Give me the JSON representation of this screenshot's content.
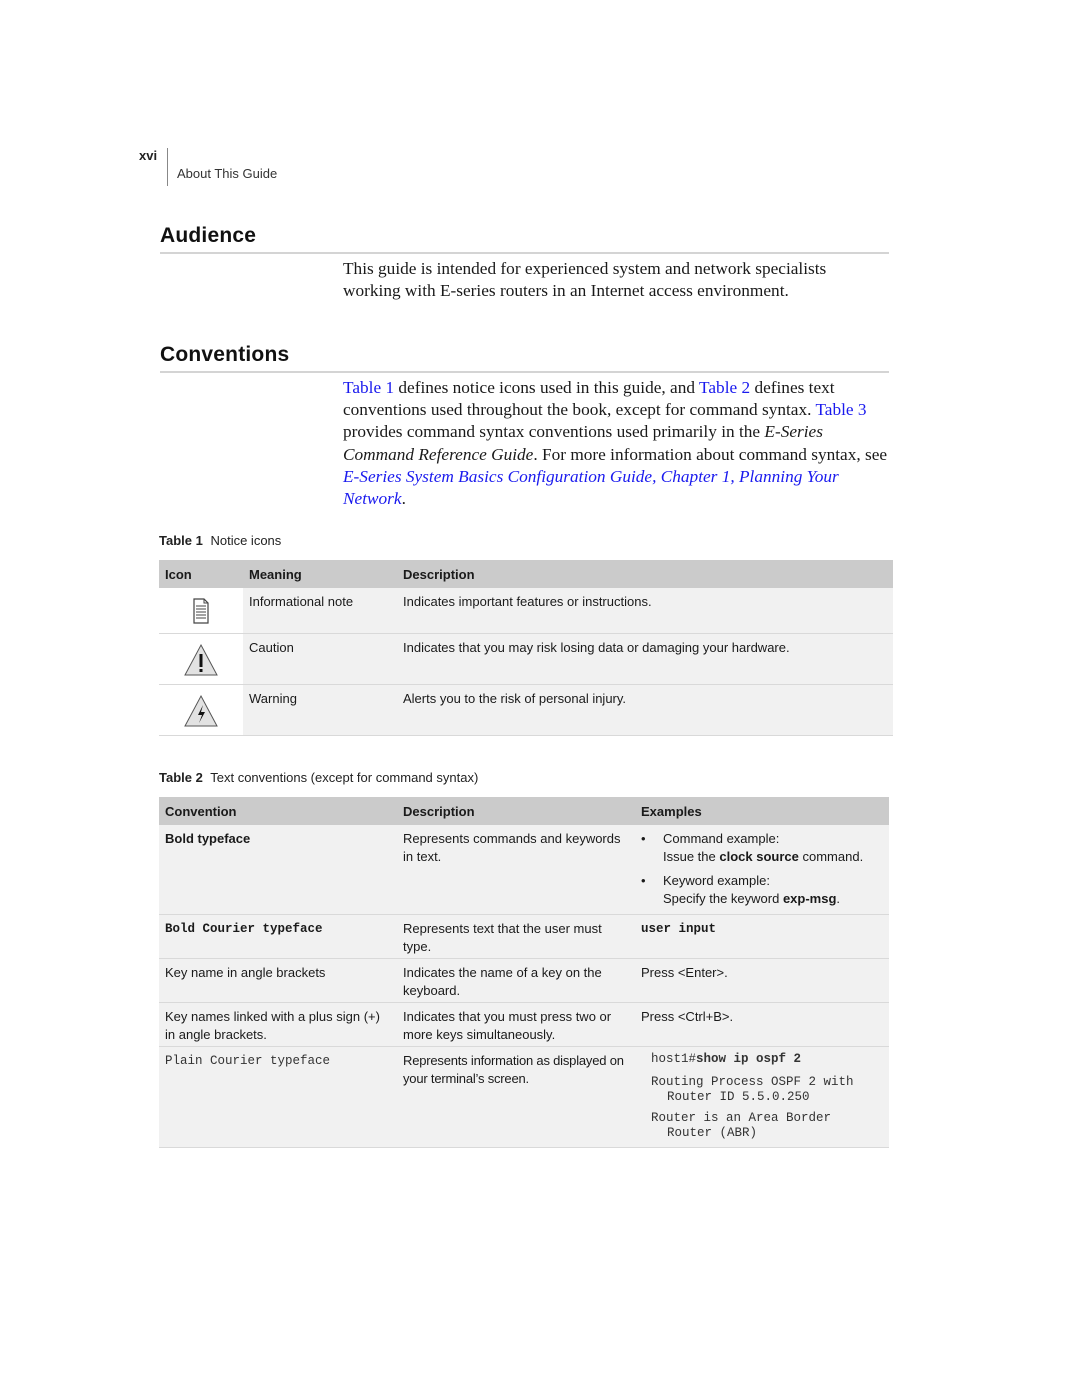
{
  "header": {
    "page_number": "xvi",
    "running_head": "About This Guide"
  },
  "audience": {
    "heading": "Audience",
    "paragraph": "This guide is intended for experienced system and network specialists working with E-series routers in an Internet access environment."
  },
  "conventions": {
    "heading": "Conventions",
    "paragraph": {
      "link_table1": "Table 1",
      "text1": " defines notice icons used in this guide, and ",
      "link_table2": "Table 2",
      "text2": " defines text conventions used throughout the book, except for command syntax. ",
      "link_table3": "Table 3",
      "text3": " provides command syntax conventions used primarily in the ",
      "italic_ref": "E-Series Command Reference Guide",
      "text4": ". For more information about command syntax, see ",
      "link_guide": "E-Series System Basics Configuration Guide, Chapter 1, Planning Your Network",
      "text5": "."
    },
    "colors": {
      "link": "#1a1aee",
      "header_bg": "#cbcbcb",
      "row_bg": "#f1f1f1"
    }
  },
  "table1": {
    "caption_label": "Table 1",
    "caption_text": "Notice icons",
    "headers": [
      "Icon",
      "Meaning",
      "Description"
    ],
    "rows": [
      {
        "icon": "note-icon",
        "meaning": "Informational note",
        "description": "Indicates important features or instructions."
      },
      {
        "icon": "caution-icon",
        "meaning": "Caution",
        "description": "Indicates that you may risk losing data or damaging your hardware."
      },
      {
        "icon": "warning-icon",
        "meaning": "Warning",
        "description": "Alerts you to the risk of personal injury."
      }
    ]
  },
  "table2": {
    "caption_label": "Table 2",
    "caption_text": "Text conventions (except for command syntax)",
    "headers": [
      "Convention",
      "Description",
      "Examples"
    ],
    "rows": [
      {
        "convention": "Bold typeface",
        "description": "Represents commands and keywords in text.",
        "examples": [
          {
            "bullet": "•",
            "line1": "Command example:",
            "pre": "Issue the ",
            "bold": "clock source",
            "post": " command."
          },
          {
            "bullet": "•",
            "line1": "Keyword example:",
            "pre": "Specify the keyword ",
            "bold": "exp-msg",
            "post": "."
          }
        ]
      },
      {
        "convention": "Bold Courier typeface",
        "description": "Represents text that the user must type.",
        "example": "user input"
      },
      {
        "convention": "Key name in angle brackets",
        "description": "Indicates the name of a key on the keyboard.",
        "example": "Press <Enter>."
      },
      {
        "convention": "Key names linked with a plus sign (+) in angle brackets.",
        "description": "Indicates that you must press two or more keys simultaneously.",
        "example": "Press <Ctrl+B>."
      },
      {
        "convention": "Plain Courier typeface",
        "description": "Represents information as displayed on your terminal’s screen.",
        "example_prompt": "host1#",
        "example_command": "show ip ospf 2",
        "example_output": [
          {
            "line1": "Routing Process OSPF 2 with",
            "line2": "Router ID 5.5.0.250"
          },
          {
            "line1": "Router is an Area Border",
            "line2": "Router (ABR)"
          }
        ]
      }
    ]
  }
}
